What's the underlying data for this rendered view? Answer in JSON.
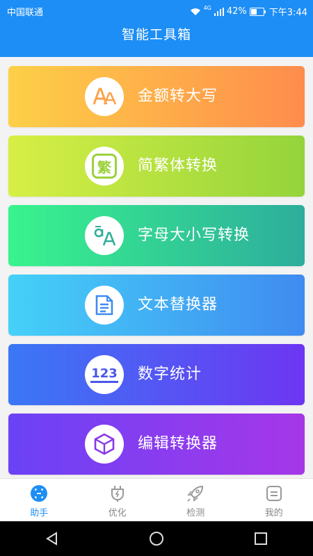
{
  "status_bar": {
    "carrier": "中国联通",
    "network": "4G",
    "battery": "42%",
    "time": "下午3:44"
  },
  "header": {
    "title": "智能工具箱"
  },
  "tools": [
    {
      "label": "金额转大写",
      "icon": "font-aa-icon",
      "colors": [
        "#fdd047",
        "#ff8c4c"
      ]
    },
    {
      "label": "简繁体转换",
      "icon": "traditional-char-icon",
      "colors": [
        "#d7ef45",
        "#94d43b"
      ]
    },
    {
      "label": "字母大小写转换",
      "icon": "letter-case-icon",
      "colors": [
        "#39f48d",
        "#2dad9c"
      ]
    },
    {
      "label": "文本替换器",
      "icon": "document-icon",
      "colors": [
        "#45d1f8",
        "#3f8bf0"
      ]
    },
    {
      "label": "数字统计",
      "icon": "number-123-icon",
      "colors": [
        "#3a78f5",
        "#6d36f2"
      ]
    },
    {
      "label": "编辑转换器",
      "icon": "cube-icon",
      "colors": [
        "#6b42f6",
        "#a637e8"
      ]
    }
  ],
  "bottom_nav": [
    {
      "label": "助手",
      "icon": "assistant-icon",
      "active": true
    },
    {
      "label": "优化",
      "icon": "optimize-plug-icon",
      "active": false
    },
    {
      "label": "检测",
      "icon": "rocket-icon",
      "active": false
    },
    {
      "label": "我的",
      "icon": "profile-icon",
      "active": false
    }
  ],
  "traditional_glyph": "繁",
  "number_glyph": "123",
  "colors": {
    "accent": "#1d8ef5",
    "inactive": "#888888"
  }
}
